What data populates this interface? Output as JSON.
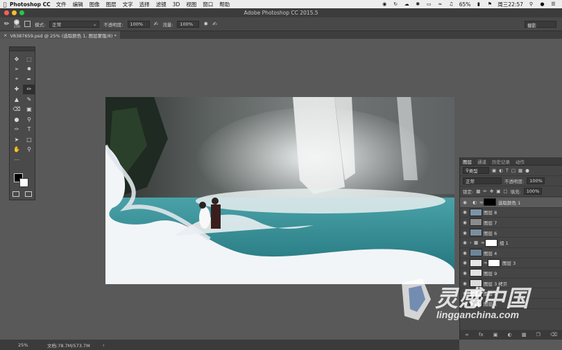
{
  "menubar": {
    "app_name": "Photoshop CC",
    "items": [
      "文件",
      "编辑",
      "图像",
      "图层",
      "文字",
      "选择",
      "滤镜",
      "3D",
      "视图",
      "窗口",
      "帮助"
    ],
    "battery": "65%",
    "clock": "周三22:57"
  },
  "window": {
    "title": "Adobe Photoshop CC 2015.5"
  },
  "options": {
    "brush_size": "100",
    "mode_label": "模式:",
    "mode_value": "正常",
    "opacity_label": "不透明度:",
    "opacity_value": "100%",
    "flow_label": "流量:",
    "flow_value": "100%",
    "workspace": "摄影"
  },
  "document": {
    "tab_title": "V8387659.psd @ 25% (选取颜色 1, 图层蒙版/8) *"
  },
  "status": {
    "zoom": "25%",
    "doc_size": "文档:78.7M/573.7M"
  },
  "layers_panel": {
    "tabs": [
      "图层",
      "通道",
      "历史记录",
      "动作"
    ],
    "filter_label": "类型",
    "blend_mode": "正常",
    "opacity_label": "不透明度:",
    "opacity_value": "100%",
    "lock_label": "锁定:",
    "fill_label": "填充:",
    "fill_value": "100%",
    "layers": [
      {
        "name": "选取颜色 1",
        "selected": true
      },
      {
        "name": "图层 8"
      },
      {
        "name": "图层 7"
      },
      {
        "name": "图层 6"
      },
      {
        "name": "组 1"
      },
      {
        "name": "图层 4"
      },
      {
        "name": "图层 3"
      },
      {
        "name": "图层 9"
      },
      {
        "name": "图层 3 拷贝"
      },
      {
        "name": "图层 2"
      },
      {
        "name": "图层 1"
      }
    ]
  },
  "watermark": {
    "brand": "灵感中国",
    "url": "lingganchina.com"
  },
  "colors": {
    "menubar_bg": "#ececec",
    "panel_bg": "#454545",
    "canvas_bg": "#595959"
  }
}
